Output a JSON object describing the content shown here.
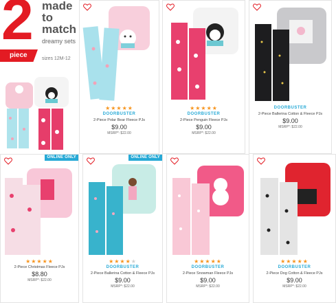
{
  "promo": {
    "big_number": "2",
    "piece_label": "piece",
    "headline": "made to match",
    "subhead": "dreamy sets",
    "sizes": "sizes 12M-12"
  },
  "colors": {
    "brand_red": "#e31b23",
    "accent_blue": "#26a9d6",
    "star_orange": "#f7941d"
  },
  "products": [
    {
      "badge": "",
      "rating": 5,
      "tag": "DOORBUSTER",
      "name": "2-Piece Polar Bear Fleece PJs",
      "price": "$9.00",
      "msrp": "MSRP*: $22.00"
    },
    {
      "badge": "",
      "rating": 4.5,
      "tag": "DOORBUSTER",
      "name": "2-Piece Penguin Fleece PJs",
      "price": "$9.00",
      "msrp": "MSRP*: $22.00"
    },
    {
      "badge": "",
      "rating": 0,
      "tag": "DOORBUSTER",
      "name": "2-Piece Ballerina Cotton & Fleece PJs",
      "price": "$9.00",
      "msrp": "MSRP*: $22.00"
    },
    {
      "badge": "ONLINE ONLY",
      "rating": 5,
      "tag": "",
      "name": "2-Piece Christmas Fleece PJs",
      "price": "$8.80",
      "msrp": "MSRP*: $22.00"
    },
    {
      "badge": "ONLINE ONLY",
      "rating": 4,
      "tag": "DOORBUSTER",
      "name": "2-Piece Ballerina Cotton & Fleece PJs",
      "price": "$9.00",
      "msrp": "MSRP*: $22.00"
    },
    {
      "badge": "",
      "rating": 5,
      "tag": "DOORBUSTER",
      "name": "2-Piece Snowman Fleece PJs",
      "price": "$9.00",
      "msrp": "MSRP*: $22.00"
    },
    {
      "badge": "",
      "rating": 5,
      "tag": "DOORBUSTER",
      "name": "2-Piece Dog Cotton & Fleece PJs",
      "price": "$9.00",
      "msrp": "MSRP*: $22.00"
    }
  ]
}
